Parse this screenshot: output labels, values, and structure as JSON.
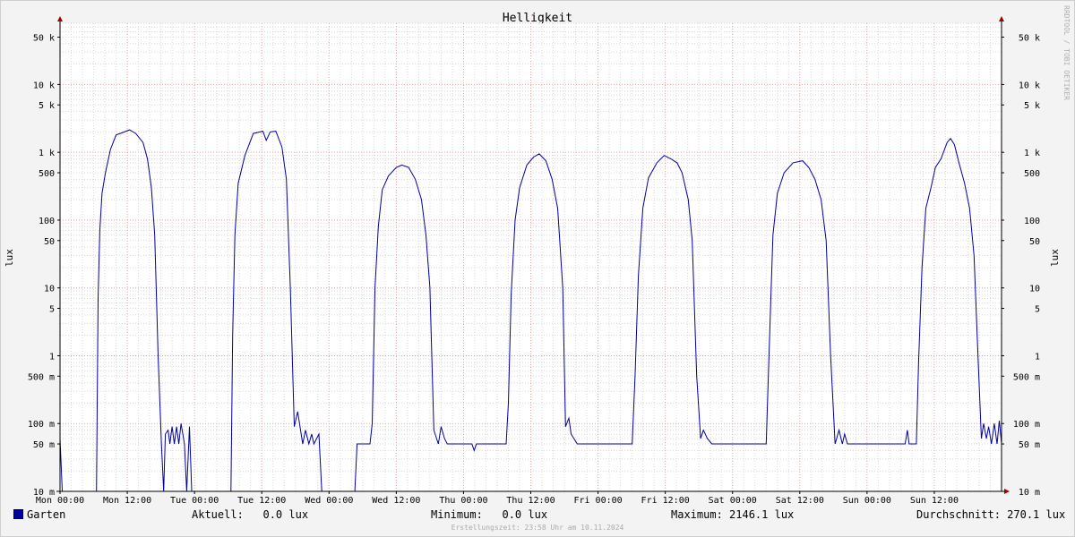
{
  "chart_data": {
    "type": "line",
    "title": "Helligkeit",
    "ylabel": "lux",
    "yscale": "log",
    "ylim": [
      0.01,
      80000
    ],
    "xlim_hours": [
      0,
      168
    ],
    "grid": true,
    "y_ticks": [
      {
        "value": 0.01,
        "label": "10 m"
      },
      {
        "value": 0.05,
        "label": "50 m"
      },
      {
        "value": 0.1,
        "label": "100 m"
      },
      {
        "value": 0.5,
        "label": "500 m"
      },
      {
        "value": 1,
        "label": "1"
      },
      {
        "value": 5,
        "label": "5"
      },
      {
        "value": 10,
        "label": "10"
      },
      {
        "value": 50,
        "label": "50"
      },
      {
        "value": 100,
        "label": "100"
      },
      {
        "value": 500,
        "label": "500"
      },
      {
        "value": 1000,
        "label": "1 k"
      },
      {
        "value": 5000,
        "label": "5 k"
      },
      {
        "value": 10000,
        "label": "10 k"
      },
      {
        "value": 50000,
        "label": "50 k"
      }
    ],
    "x_ticks": [
      {
        "hour": 0,
        "label": "Mon 00:00"
      },
      {
        "hour": 12,
        "label": "Mon 12:00"
      },
      {
        "hour": 24,
        "label": "Tue 00:00"
      },
      {
        "hour": 36,
        "label": "Tue 12:00"
      },
      {
        "hour": 48,
        "label": "Wed 00:00"
      },
      {
        "hour": 60,
        "label": "Wed 12:00"
      },
      {
        "hour": 72,
        "label": "Thu 00:00"
      },
      {
        "hour": 84,
        "label": "Thu 12:00"
      },
      {
        "hour": 96,
        "label": "Fri 00:00"
      },
      {
        "hour": 108,
        "label": "Fri 12:00"
      },
      {
        "hour": 120,
        "label": "Sat 00:00"
      },
      {
        "hour": 132,
        "label": "Sat 12:00"
      },
      {
        "hour": 144,
        "label": "Sun 00:00"
      },
      {
        "hour": 156,
        "label": "Sun 12:00"
      }
    ],
    "series": [
      {
        "name": "Garten",
        "color": "#0000a0",
        "points": [
          [
            0,
            0.06
          ],
          [
            0.4,
            0.01
          ],
          [
            6.5,
            0.01
          ],
          [
            6.8,
            7
          ],
          [
            7.1,
            70
          ],
          [
            7.5,
            250
          ],
          [
            8.1,
            500
          ],
          [
            9,
            1100
          ],
          [
            10,
            1800
          ],
          [
            11.5,
            2000
          ],
          [
            12.4,
            2146
          ],
          [
            13.5,
            1900
          ],
          [
            14.8,
            1400
          ],
          [
            15.6,
            800
          ],
          [
            16.3,
            300
          ],
          [
            16.9,
            60
          ],
          [
            17.5,
            1
          ],
          [
            18.1,
            0.05
          ],
          [
            18.5,
            0.01
          ],
          [
            18.8,
            0.07
          ],
          [
            19.3,
            0.08
          ],
          [
            19.6,
            0.05
          ],
          [
            20,
            0.09
          ],
          [
            20.4,
            0.05
          ],
          [
            20.8,
            0.09
          ],
          [
            21.2,
            0.05
          ],
          [
            21.6,
            0.1
          ],
          [
            22.2,
            0.05
          ],
          [
            22.6,
            0.01
          ],
          [
            23.1,
            0.09
          ],
          [
            23.5,
            0.01
          ],
          [
            30.5,
            0.01
          ],
          [
            30.8,
            2
          ],
          [
            31.2,
            60
          ],
          [
            31.8,
            350
          ],
          [
            33,
            900
          ],
          [
            34.5,
            1900
          ],
          [
            36.2,
            2050
          ],
          [
            36.8,
            1500
          ],
          [
            37.5,
            2000
          ],
          [
            38.5,
            2050
          ],
          [
            39.6,
            1200
          ],
          [
            40.4,
            400
          ],
          [
            41.1,
            10
          ],
          [
            41.8,
            0.09
          ],
          [
            42.4,
            0.15
          ],
          [
            43.3,
            0.05
          ],
          [
            43.8,
            0.08
          ],
          [
            44.4,
            0.05
          ],
          [
            44.9,
            0.07
          ],
          [
            45.3,
            0.05
          ],
          [
            46.2,
            0.07
          ],
          [
            46.7,
            0.01
          ],
          [
            52.6,
            0.01
          ],
          [
            53,
            0.05
          ],
          [
            55.3,
            0.05
          ],
          [
            55.7,
            0.1
          ],
          [
            56.2,
            10
          ],
          [
            56.8,
            80
          ],
          [
            57.5,
            280
          ],
          [
            58.6,
            450
          ],
          [
            60,
            600
          ],
          [
            61,
            650
          ],
          [
            62.2,
            600
          ],
          [
            63.4,
            400
          ],
          [
            64.5,
            200
          ],
          [
            65.3,
            60
          ],
          [
            66,
            10
          ],
          [
            66.7,
            0.08
          ],
          [
            67.5,
            0.05
          ],
          [
            68,
            0.09
          ],
          [
            68.6,
            0.06
          ],
          [
            69.1,
            0.05
          ],
          [
            73.5,
            0.05
          ],
          [
            73.9,
            0.04
          ],
          [
            74.3,
            0.05
          ],
          [
            79.6,
            0.05
          ],
          [
            80,
            0.2
          ],
          [
            80.5,
            8
          ],
          [
            81.2,
            100
          ],
          [
            82,
            300
          ],
          [
            83.3,
            650
          ],
          [
            84.5,
            850
          ],
          [
            85.5,
            950
          ],
          [
            86.7,
            750
          ],
          [
            87.8,
            400
          ],
          [
            88.8,
            150
          ],
          [
            89.7,
            10
          ],
          [
            90.2,
            0.09
          ],
          [
            90.8,
            0.12
          ],
          [
            91.2,
            0.07
          ],
          [
            92.3,
            0.05
          ],
          [
            102.1,
            0.05
          ],
          [
            102.6,
            0.5
          ],
          [
            103.2,
            15
          ],
          [
            104,
            150
          ],
          [
            105,
            420
          ],
          [
            106.5,
            700
          ],
          [
            107.8,
            900
          ],
          [
            109,
            800
          ],
          [
            110.1,
            700
          ],
          [
            111,
            500
          ],
          [
            112.1,
            200
          ],
          [
            112.8,
            50
          ],
          [
            113.6,
            0.5
          ],
          [
            114.3,
            0.06
          ],
          [
            114.8,
            0.08
          ],
          [
            115.5,
            0.06
          ],
          [
            116.3,
            0.05
          ],
          [
            126,
            0.05
          ],
          [
            126.5,
            1
          ],
          [
            127.2,
            60
          ],
          [
            128,
            250
          ],
          [
            129.2,
            500
          ],
          [
            130.8,
            700
          ],
          [
            132.5,
            750
          ],
          [
            133.6,
            600
          ],
          [
            134.7,
            400
          ],
          [
            135.8,
            200
          ],
          [
            136.7,
            50
          ],
          [
            137.5,
            1
          ],
          [
            138.3,
            0.05
          ],
          [
            139,
            0.08
          ],
          [
            139.6,
            0.05
          ],
          [
            140,
            0.07
          ],
          [
            140.5,
            0.05
          ],
          [
            150.8,
            0.05
          ],
          [
            151.2,
            0.08
          ],
          [
            151.5,
            0.05
          ],
          [
            152.8,
            0.05
          ],
          [
            153.2,
            0.8
          ],
          [
            153.8,
            20
          ],
          [
            154.5,
            150
          ],
          [
            155.4,
            300
          ],
          [
            156.2,
            600
          ],
          [
            157.2,
            800
          ],
          [
            158.3,
            1400
          ],
          [
            158.9,
            1600
          ],
          [
            159.6,
            1300
          ],
          [
            160.4,
            700
          ],
          [
            161.4,
            350
          ],
          [
            162.3,
            150
          ],
          [
            163.1,
            30
          ],
          [
            163.8,
            1
          ],
          [
            164.4,
            0.06
          ],
          [
            164.8,
            0.1
          ],
          [
            165.3,
            0.06
          ],
          [
            165.7,
            0.09
          ],
          [
            166.2,
            0.05
          ],
          [
            166.7,
            0.1
          ],
          [
            167.2,
            0.05
          ],
          [
            167.6,
            0.11
          ],
          [
            168,
            0.05
          ]
        ]
      }
    ],
    "legend": {
      "series_name": "Garten",
      "aktuell": "Aktuell:   0.0 lux",
      "minimum": "Minimum:   0.0 lux",
      "maximum": "Maximum: 2146.1 lux",
      "durchschnitt": "Durchschnitt: 270.1 lux"
    }
  },
  "footer": "Erstellungszeit: 23:58 Uhr am 10.11.2024",
  "watermark": "RRDTOOL / TOBI OETIKER",
  "colors": {
    "line": "#0000a0",
    "grid_major": "#e8a0a0",
    "grid_minor": "#d8d8d8"
  }
}
